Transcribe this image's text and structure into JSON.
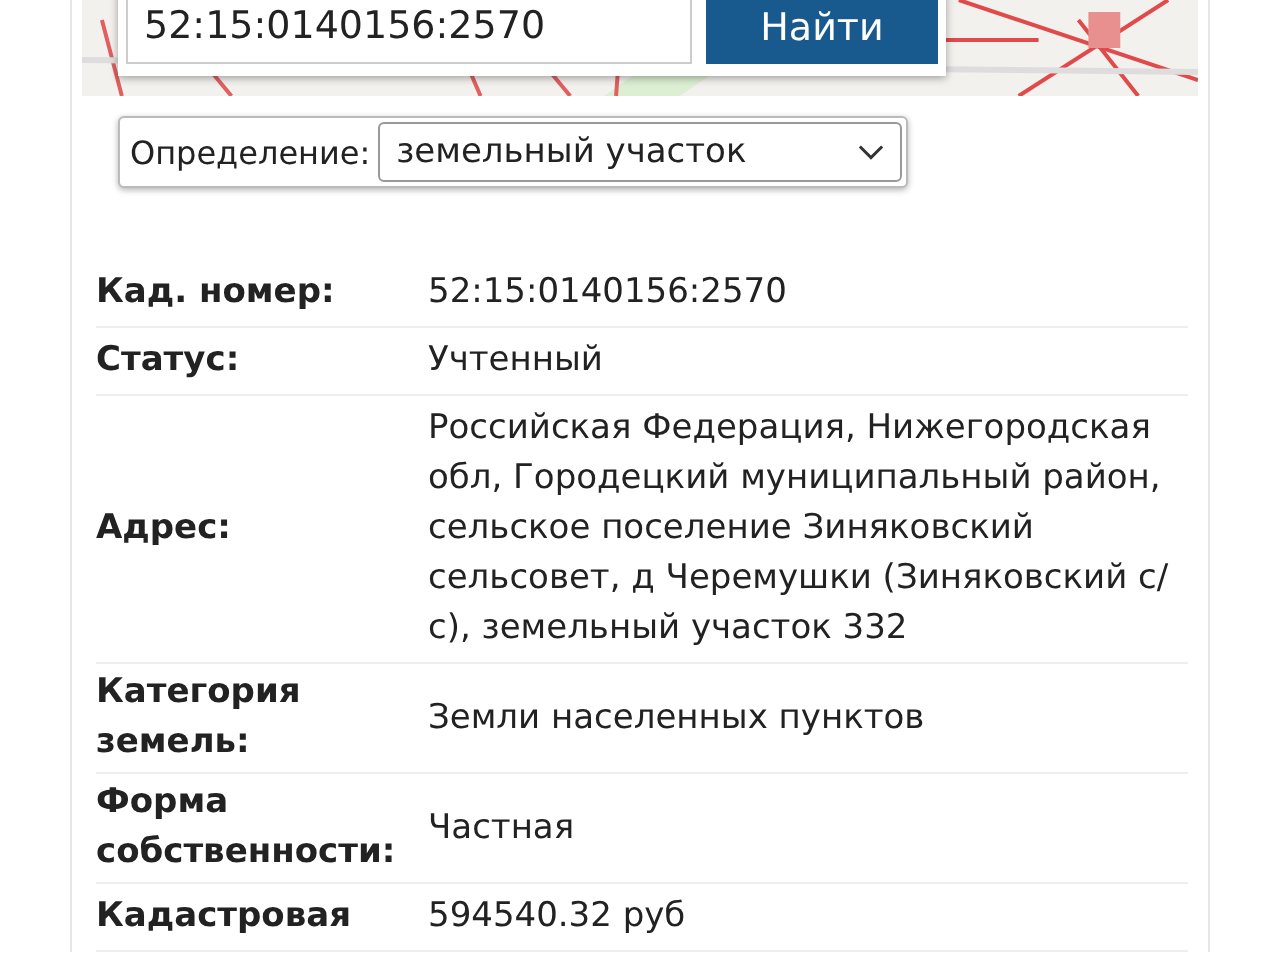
{
  "search": {
    "value": "52:15:0140156:2570",
    "button": "Найти"
  },
  "definition": {
    "label": "Определение:",
    "value": "земельный участок"
  },
  "rows": [
    {
      "label": "Кад. номер:",
      "value": "52:15:0140156:2570"
    },
    {
      "label": "Статус:",
      "value": "Учтенный"
    },
    {
      "label": "Адрес:",
      "value": "Российская Федерация, Нижегородская обл, Городецкий муниципальный район, сельское поселение Зиняковский сельсовет, д Черемушки (Зиняковский с/с), земельный участок 332"
    },
    {
      "label": "Категория земель:",
      "value": "Земли населенных пунктов"
    },
    {
      "label": "Форма собственности:",
      "value": "Частная"
    },
    {
      "label": "Кадастровая",
      "value": "594540.32 руб"
    }
  ]
}
